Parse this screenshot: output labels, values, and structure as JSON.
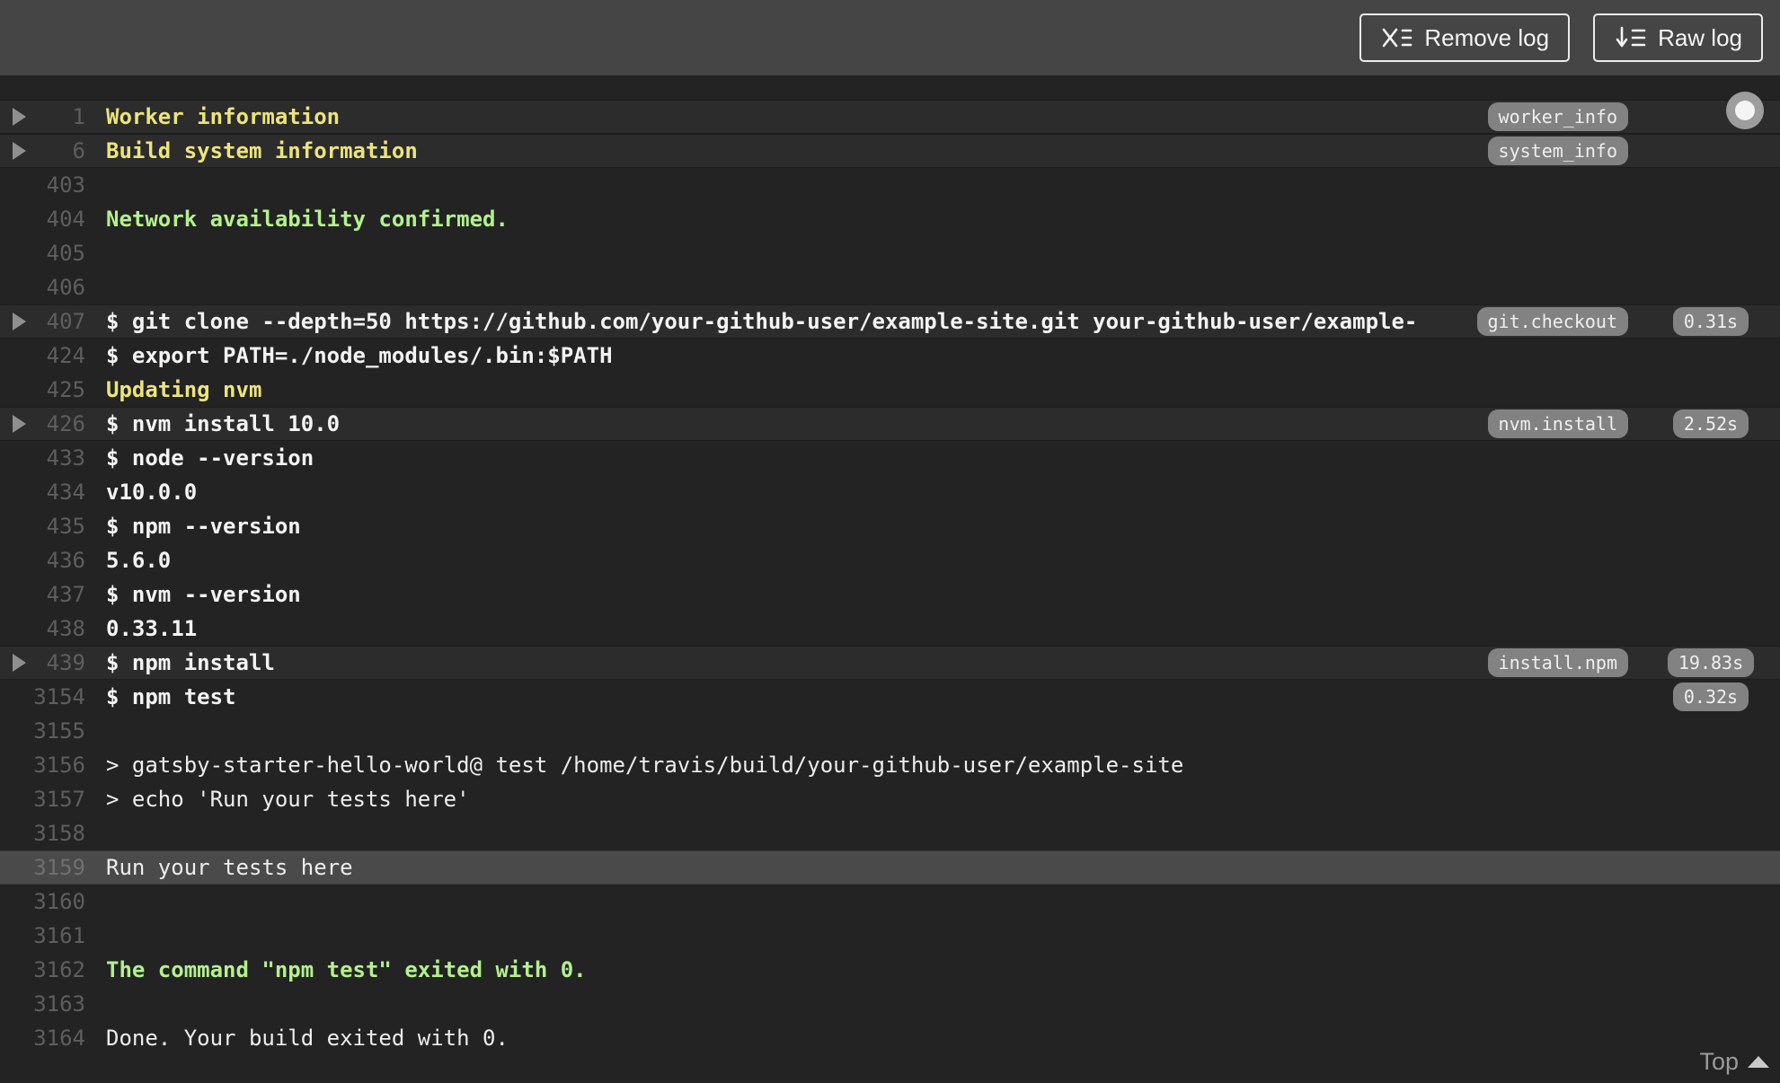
{
  "toolbar": {
    "remove_log_label": "Remove log",
    "raw_log_label": "Raw log"
  },
  "colors": {
    "toolbar_bg": "#454545",
    "log_bg": "#232323",
    "row_highlight": "#2c2c2c",
    "selected_row": "#4a4a4a",
    "fold_title_yellow": "#ece47c",
    "success_green": "#b4f08e",
    "command_white": "#f3f3f3",
    "line_number_gray": "#5e5e5e",
    "pill_bg": "#828282"
  },
  "icons": {
    "remove_log": "x-list-icon",
    "raw_log": "download-list-icon",
    "fold": "triangle-right-icon",
    "top": "triangle-up-icon",
    "follow_toggle": "circle-knob-icon"
  },
  "log": {
    "lines": [
      {
        "number": "1",
        "text": "Worker information",
        "type": "fold-title",
        "fold": true,
        "tag": "worker_info",
        "row_highlight": true
      },
      {
        "number": "6",
        "text": "Build system information",
        "type": "fold-title",
        "fold": true,
        "tag": "system_info",
        "row_highlight": true
      },
      {
        "number": "403",
        "text": "",
        "type": "empty"
      },
      {
        "number": "404",
        "text": "Network availability confirmed.",
        "type": "success"
      },
      {
        "number": "405",
        "text": "",
        "type": "empty"
      },
      {
        "number": "406",
        "text": "",
        "type": "empty"
      },
      {
        "number": "407",
        "text": "$ git clone --depth=50 https://github.com/your-github-user/example-site.git your-github-user/example-",
        "type": "command",
        "fold": true,
        "tag": "git.checkout",
        "time": "0.31s",
        "row_highlight": true
      },
      {
        "number": "424",
        "text": "$ export PATH=./node_modules/.bin:$PATH",
        "type": "command"
      },
      {
        "number": "425",
        "text": "Updating nvm",
        "type": "note"
      },
      {
        "number": "426",
        "text": "$ nvm install 10.0",
        "type": "command",
        "fold": true,
        "tag": "nvm.install",
        "time": "2.52s",
        "row_highlight": true
      },
      {
        "number": "433",
        "text": "$ node --version",
        "type": "command"
      },
      {
        "number": "434",
        "text": "v10.0.0",
        "type": "output-bold"
      },
      {
        "number": "435",
        "text": "$ npm --version",
        "type": "command"
      },
      {
        "number": "436",
        "text": "5.6.0",
        "type": "output-bold"
      },
      {
        "number": "437",
        "text": "$ nvm --version",
        "type": "command"
      },
      {
        "number": "438",
        "text": "0.33.11",
        "type": "output-bold"
      },
      {
        "number": "439",
        "text": "$ npm install",
        "type": "command",
        "fold": true,
        "tag": "install.npm",
        "time": "19.83s",
        "row_highlight": true
      },
      {
        "number": "3154",
        "text": "$ npm test",
        "type": "command",
        "time": "0.32s"
      },
      {
        "number": "3155",
        "text": "",
        "type": "empty"
      },
      {
        "number": "3156",
        "text": "> gatsby-starter-hello-world@ test /home/travis/build/your-github-user/example-site",
        "type": "output"
      },
      {
        "number": "3157",
        "text": "> echo 'Run your tests here'",
        "type": "output"
      },
      {
        "number": "3158",
        "text": "",
        "type": "empty"
      },
      {
        "number": "3159",
        "text": "Run your tests here",
        "type": "output",
        "selected": true
      },
      {
        "number": "3160",
        "text": "",
        "type": "empty"
      },
      {
        "number": "3161",
        "text": "",
        "type": "empty"
      },
      {
        "number": "3162",
        "text": "The command \"npm test\" exited with 0.",
        "type": "success"
      },
      {
        "number": "3163",
        "text": "",
        "type": "empty"
      },
      {
        "number": "3164",
        "text": "Done. Your build exited with 0.",
        "type": "output"
      }
    ]
  },
  "footer": {
    "top_label": "Top"
  }
}
